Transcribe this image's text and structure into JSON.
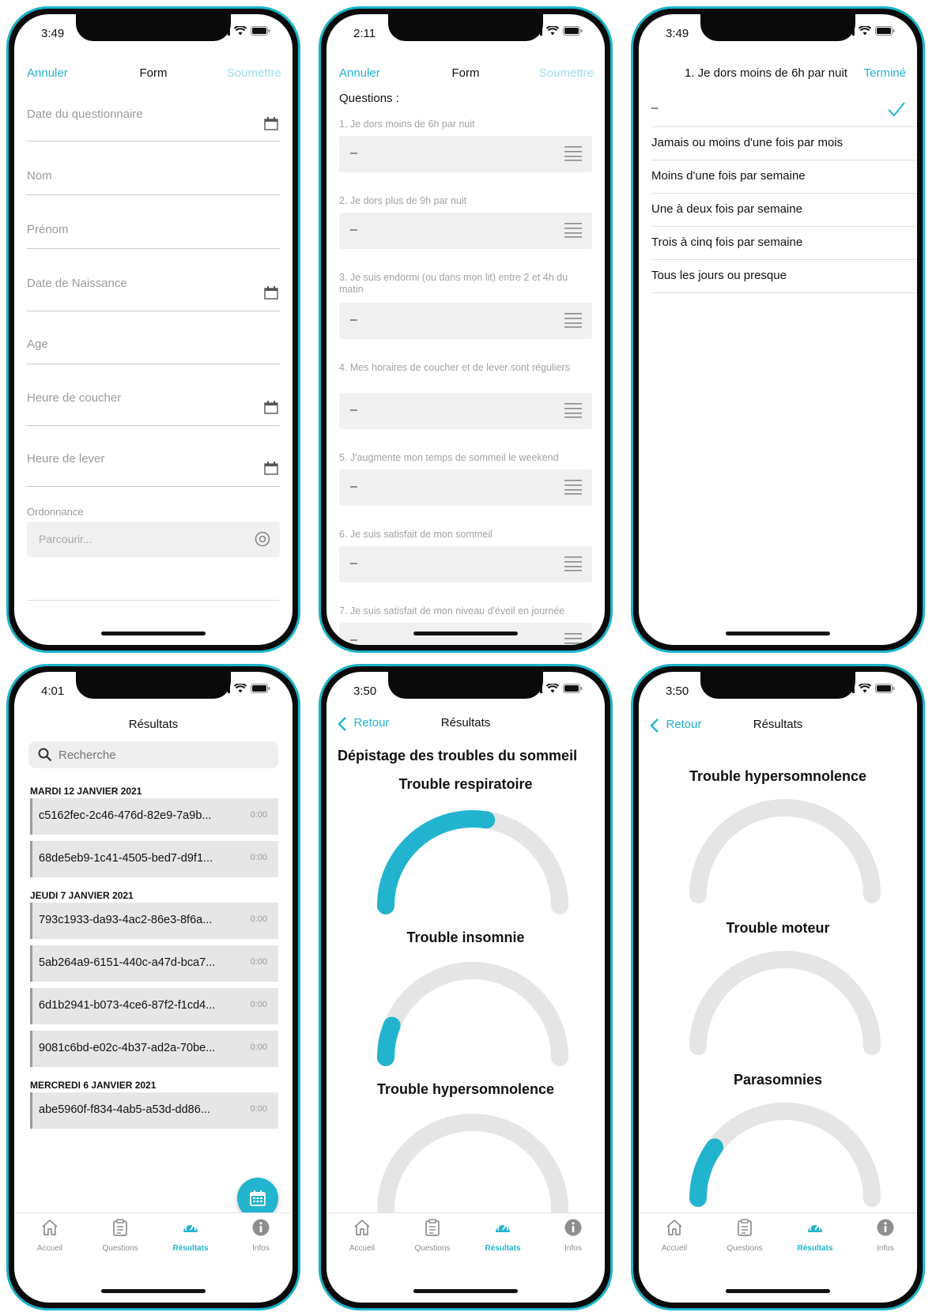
{
  "colors": {
    "accent": "#22b4ce",
    "accent_light": "#9fdce7",
    "frame": "#1ab3c9",
    "track": "#e5e5e5"
  },
  "common": {
    "nav_cancel": "Annuler",
    "nav_form": "Form",
    "nav_submit": "Soumettre",
    "nav_back": "Retour",
    "nav_results": "Résultats"
  },
  "tabs": [
    {
      "label": "Accueil",
      "icon": "home-icon"
    },
    {
      "label": "Questions",
      "icon": "clipboard-icon"
    },
    {
      "label": "Résultats",
      "icon": "speedometer-icon"
    },
    {
      "label": "Infos",
      "icon": "info-icon"
    }
  ],
  "screen1": {
    "time": "3:49",
    "fields": [
      "Date du questionnaire",
      "Nom",
      "Prénom",
      "Date de Naissance",
      "Age",
      "Heure de coucher",
      "Heure de lever"
    ],
    "ordonnance_label": "Ordonnance",
    "browse_placeholder": "Parcourir..."
  },
  "screen2": {
    "time": "2:11",
    "section_title": "Questions :",
    "questions": [
      "1. Je dors moins de 6h par nuit",
      "2. Je dors plus de 9h par nuit",
      "3. Je suis endormi (ou dans mon lit) entre 2 et 4h du matin",
      "4. Mes horaires de coucher et de lever sont réguliers",
      "5. J'augmente mon temps de sommeil le weekend",
      "6. Je suis satisfait de mon sommeil",
      "7. Je suis satisfait de mon niveau d'éveil en journée"
    ],
    "answer_placeholder": "–"
  },
  "screen3": {
    "time": "3:49",
    "title": "1. Je dors moins de 6h par nuit",
    "done": "Terminé",
    "selected": "–",
    "options": [
      "Jamais ou moins d'une fois par mois",
      "Moins d'une fois par semaine",
      "Une à deux fois par semaine",
      "Trois à cinq fois par semaine",
      "Tous les jours ou presque"
    ]
  },
  "screen4": {
    "time": "4:01",
    "title": "Résultats",
    "search_placeholder": "Recherche",
    "groups": [
      {
        "date": "MARDI 12 JANVIER 2021",
        "items": [
          {
            "id": "c5162fec-2c46-476d-82e9-7a9b...",
            "time": "0:00"
          },
          {
            "id": "68de5eb9-1c41-4505-bed7-d9f1...",
            "time": "0:00"
          }
        ]
      },
      {
        "date": "JEUDI 7 JANVIER 2021",
        "items": [
          {
            "id": "793c1933-da93-4ac2-86e3-8f6a...",
            "time": "0:00"
          },
          {
            "id": "5ab264a9-6151-440c-a47d-bca7...",
            "time": "0:00"
          },
          {
            "id": "6d1b2941-b073-4ce6-87f2-f1cd4...",
            "time": "0:00"
          },
          {
            "id": "9081c6bd-e02c-4b37-ad2a-70be...",
            "time": "0:00"
          }
        ]
      },
      {
        "date": "MERCREDI 6 JANVIER 2021",
        "items": [
          {
            "id": "abe5960f-f834-4ab5-a53d-dd86...",
            "time": "0:00"
          }
        ]
      }
    ]
  },
  "screen5": {
    "time": "3:50",
    "heading": "Dépistage des troubles du sommeil",
    "gauges": [
      {
        "label": "Trouble respiratoire",
        "fraction": 0.55
      },
      {
        "label": "Trouble insomnie",
        "fraction": 0.12
      },
      {
        "label": "Trouble hypersomnolence",
        "fraction": 0.0
      }
    ]
  },
  "screen6": {
    "time": "3:50",
    "gauges": [
      {
        "label": "Trouble hypersomnolence",
        "fraction": 0.0
      },
      {
        "label": "Trouble moteur",
        "fraction": 0.0
      },
      {
        "label": "Parasomnies",
        "fraction": 0.2
      }
    ]
  }
}
